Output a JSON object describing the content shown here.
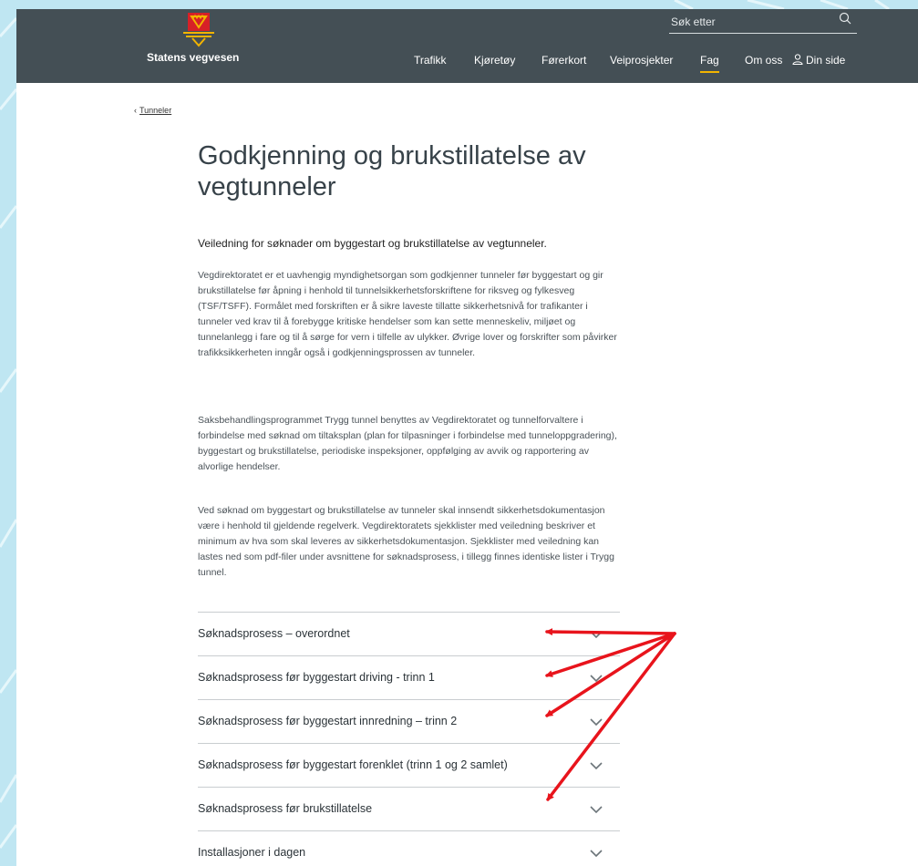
{
  "brand": {
    "name": "Statens vegvesen"
  },
  "search": {
    "placeholder": "Søk etter"
  },
  "nav": {
    "items": [
      {
        "label": "Trafikk"
      },
      {
        "label": "Kjøretøy"
      },
      {
        "label": "Førerkort"
      },
      {
        "label": "Veiprosjekter"
      },
      {
        "label": "Fag",
        "active": true
      },
      {
        "label": "Om oss"
      },
      {
        "label": "Din side"
      }
    ]
  },
  "breadcrumb": {
    "label": "Tunneler"
  },
  "page": {
    "title": "Godkjenning og brukstillatelse av vegtunneler",
    "lead": "Veiledning for søknader om byggestart og brukstillatelse av vegtunneler.",
    "paragraphs": [
      "Vegdirektoratet er et uavhengig myndighetsorgan som godkjenner tunneler før byggestart og gir brukstillatelse før åpning i henhold til tunnelsikkerhetsforskriftene for riksveg og fylkesveg (TSF/TSFF). Formålet med forskriften er å sikre laveste tillatte sikkerhetsnivå for trafikanter i tunneler ved krav til å forebygge kritiske hendelser som kan sette menneskeliv, miljøet og tunnelanlegg i fare og til å sørge for vern i tilfelle av ulykker. Øvrige lover og forskrifter som påvirker trafikksikkerheten inngår også i godkjenningsprossen av tunneler.",
      "Saksbehandlingsprogrammet Trygg tunnel benyttes av Vegdirektoratet og tunnelforvaltere i forbindelse med søknad om tiltaksplan (plan for tilpasninger i forbindelse med tunneloppgradering), byggestart og brukstillatelse, periodiske inspeksjoner, oppfølging av avvik og rapportering av alvorlige hendelser.",
      "Ved søknad om byggestart og brukstillatelse av tunneler skal innsendt sikkerhetsdokumentasjon være i henhold til gjeldende regelverk. Vegdirektoratets sjekklister med veiledning beskriver et minimum av hva som skal leveres av sikkerhetsdokumentasjon. Sjekklister med veiledning kan lastes ned som pdf-filer under avsnittene for søknadsprosess, i tillegg finnes identiske lister i Trygg tunnel."
    ]
  },
  "accordion": {
    "items": [
      {
        "label": "Søknadsprosess – overordnet"
      },
      {
        "label": "Søknadsprosess før byggestart driving - trinn 1"
      },
      {
        "label": "Søknadsprosess før byggestart innredning – trinn 2"
      },
      {
        "label": "Søknadsprosess før byggestart forenklet (trinn 1 og 2 samlet)"
      },
      {
        "label": "Søknadsprosess før brukstillatelse"
      },
      {
        "label": "Installasjoner i dagen"
      }
    ]
  },
  "colors": {
    "header_bg": "#444f55",
    "active_underline": "#f2b400",
    "annotation_arrow": "#e8141c",
    "logo_red": "#d72027",
    "logo_yellow": "#f2b400"
  },
  "icons": [
    "logo-emblem-icon",
    "search-icon",
    "person-icon",
    "chevron-left-icon",
    "chevron-down-icon",
    "annotation-arrow-icon"
  ]
}
